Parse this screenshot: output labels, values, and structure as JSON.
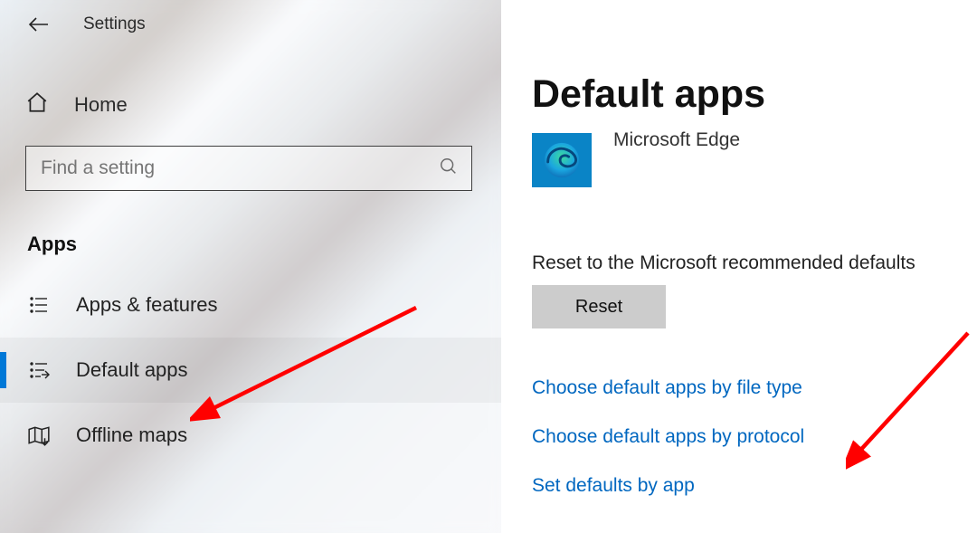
{
  "header": {
    "title": "Settings"
  },
  "sidebar": {
    "home_label": "Home",
    "search_placeholder": "Find a setting",
    "section_label": "Apps",
    "items": [
      {
        "label": "Apps & features"
      },
      {
        "label": "Default apps"
      },
      {
        "label": "Offline maps"
      }
    ],
    "selected_index": 1
  },
  "main": {
    "title": "Default apps",
    "current_app": {
      "name": "Microsoft Edge"
    },
    "reset_caption": "Reset to the Microsoft recommended defaults",
    "reset_button": "Reset",
    "links": [
      "Choose default apps by file type",
      "Choose default apps by protocol",
      "Set defaults by app"
    ]
  },
  "annotations": {
    "arrow1_target": "sidebar.items.1.label",
    "arrow2_target": "main.links.1",
    "color": "#ff0000"
  }
}
